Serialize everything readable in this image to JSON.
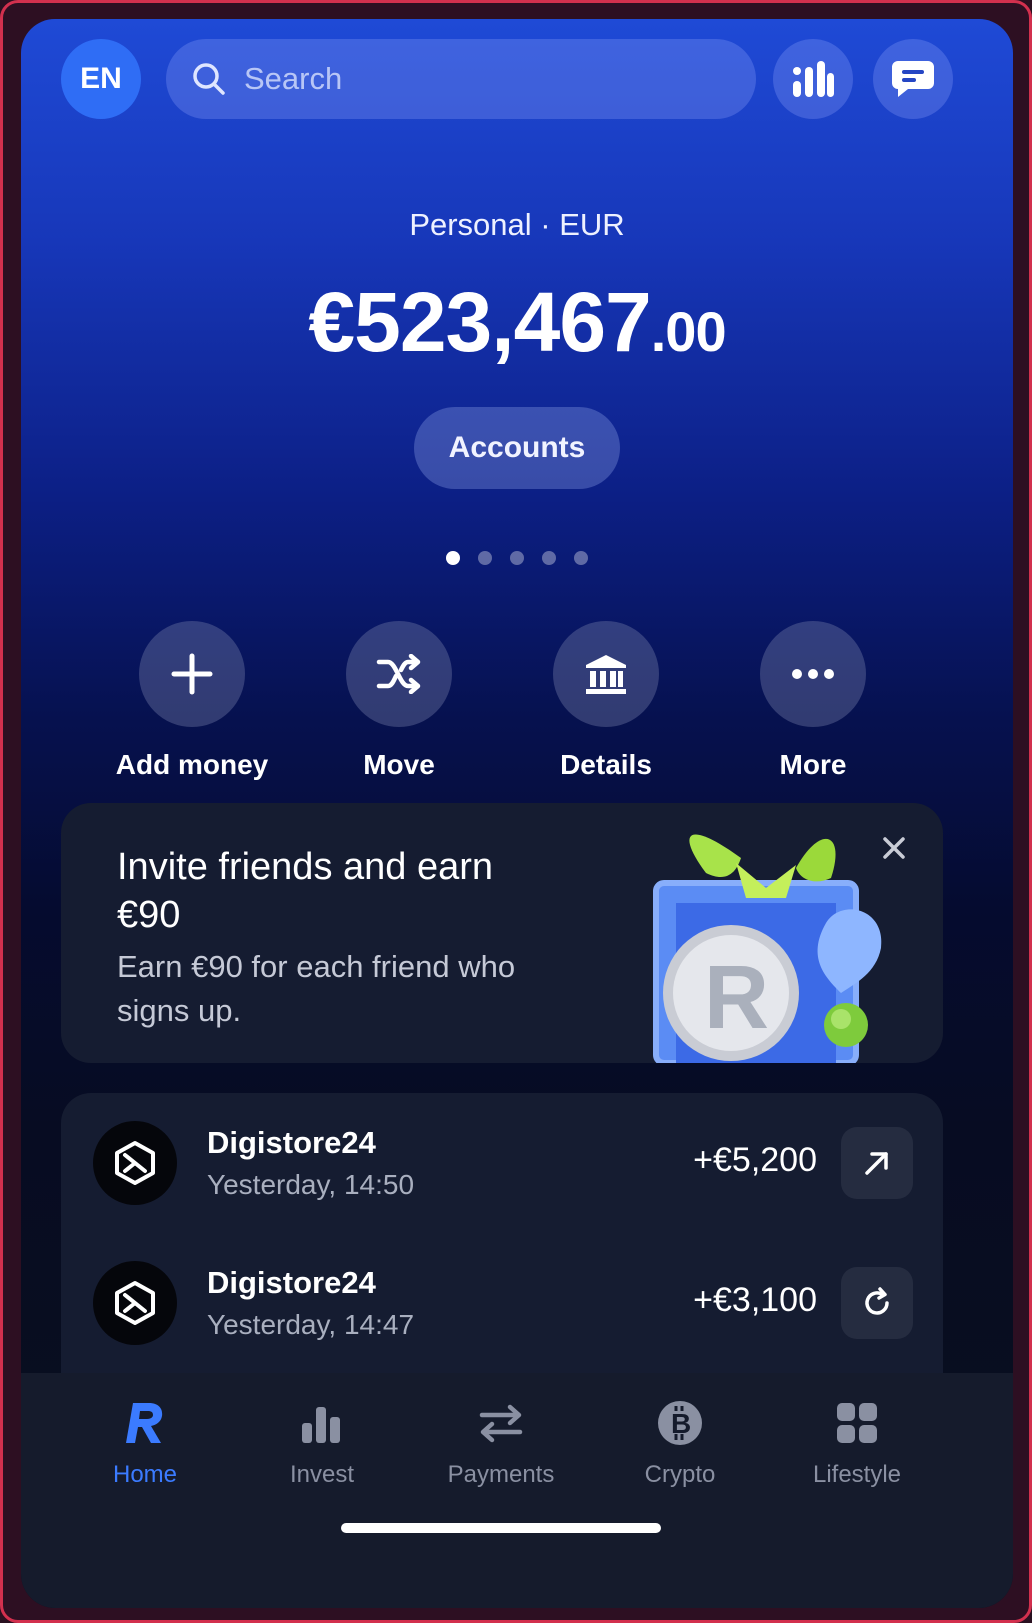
{
  "header": {
    "language_badge": "EN",
    "search_placeholder": "Search",
    "stats_icon": "bar-chart-icon",
    "chat_icon": "chat-bubble-icon"
  },
  "account": {
    "label": "Personal · EUR",
    "balance_main": "€523,467",
    "balance_decimals": ".00",
    "accounts_button": "Accounts",
    "page_dots": 5,
    "active_dot": 0
  },
  "actions": [
    {
      "label": "Add money",
      "icon": "plus-icon"
    },
    {
      "label": "Move",
      "icon": "shuffle-icon"
    },
    {
      "label": "Details",
      "icon": "bank-icon"
    },
    {
      "label": "More",
      "icon": "ellipsis-icon"
    }
  ],
  "promo": {
    "title": "Invite friends and earn €90",
    "subtitle": "Earn €90 for each friend who signs up.",
    "close_icon": "close-icon"
  },
  "transactions": [
    {
      "merchant": "Digistore24",
      "time": "Yesterday, 14:50",
      "amount": "+€5,200",
      "status_icon": "arrow-up-right-icon"
    },
    {
      "merchant": "Digistore24",
      "time": "Yesterday, 14:47",
      "amount": "+€3,100",
      "status_icon": "refresh-icon"
    }
  ],
  "nav": [
    {
      "label": "Home",
      "icon": "revolut-r-icon",
      "active": true
    },
    {
      "label": "Invest",
      "icon": "bar-chart-icon",
      "active": false
    },
    {
      "label": "Payments",
      "icon": "transfer-arrows-icon",
      "active": false
    },
    {
      "label": "Crypto",
      "icon": "bitcoin-icon",
      "active": false
    },
    {
      "label": "Lifestyle",
      "icon": "grid-icon",
      "active": false
    }
  ],
  "colors": {
    "accent": "#3b7bff",
    "avatar": "#2f6df5",
    "card": "#151c31",
    "frame_border": "#d2304e"
  }
}
